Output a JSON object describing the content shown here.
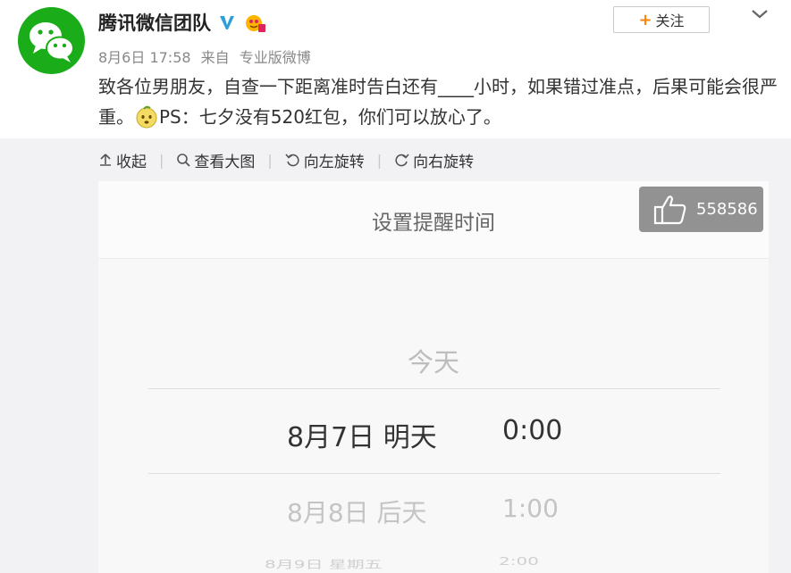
{
  "post": {
    "author": "腾讯微信团队",
    "date": "8月6日 17:58",
    "source_prefix": "来自",
    "source": "专业版微博",
    "follow_label": "关注",
    "text_part1": "致各位男朋友，自查一下距离准时告白还有____小时，如果错过准点，后果可能会很严重。",
    "text_part2": "PS：七夕没有520红包，你们可以放心了。"
  },
  "toolbar": {
    "collapse": "收起",
    "view_large": "查看大图",
    "rotate_left": "向左旋转",
    "rotate_right": "向右旋转"
  },
  "image": {
    "title": "设置提醒时间",
    "like_count": "558586",
    "picker": {
      "today": "今天",
      "selected_day": "8月7日 明天",
      "selected_time": "0:00",
      "next_day": "8月8日 后天",
      "next_time": "1:00",
      "third_day": "8月9日 星期五",
      "third_time": "2:00"
    }
  },
  "colors": {
    "wechat_green": "#1aad19",
    "follow_plus": "#ff8200",
    "verify_blue": "#2f9dd8"
  }
}
